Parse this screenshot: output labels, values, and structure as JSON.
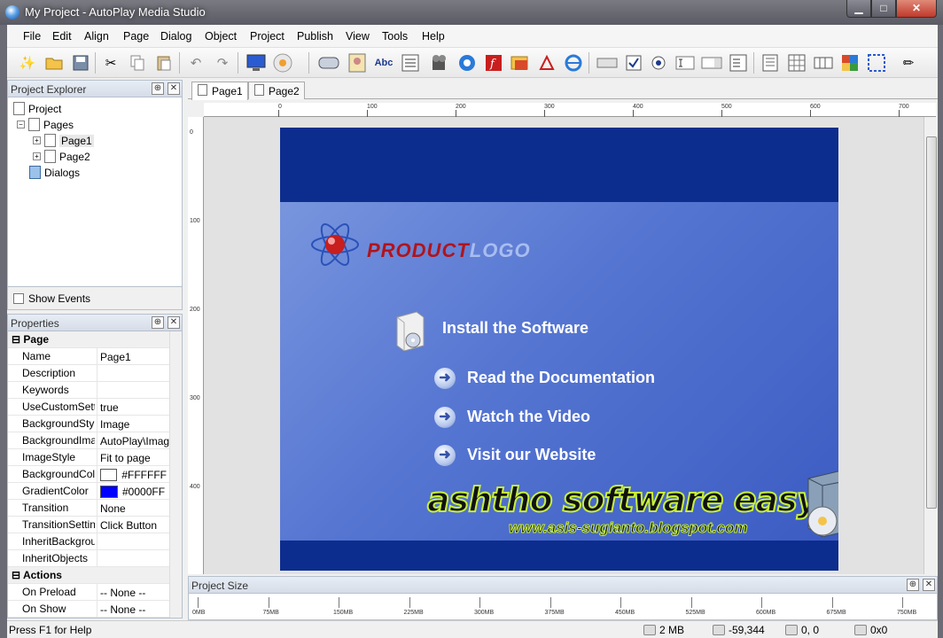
{
  "window": {
    "title": "My Project - AutoPlay Media Studio",
    "controls": {
      "minimize": "▁",
      "maximize": "□",
      "close": "✕"
    }
  },
  "menubar": [
    "File",
    "Edit",
    "Align",
    "Page",
    "Dialog",
    "Object",
    "Project",
    "Publish",
    "View",
    "Tools",
    "Help"
  ],
  "toolbar": {
    "icons": [
      "wizard-icon",
      "open-folder-icon",
      "save-icon",
      "cut-icon",
      "copy-icon",
      "paste-icon",
      "undo-icon",
      "redo-icon",
      "preview-icon",
      "build-icon",
      "button-object-icon",
      "image-object-icon",
      "label-object-icon",
      "paragraph-object-icon",
      "video-object-icon",
      "quicktime-object-icon",
      "flash-object-icon",
      "slideshow-object-icon",
      "pdf-object-icon",
      "web-object-icon",
      "input-object-icon",
      "checkbox-object-icon",
      "radio-object-icon",
      "textbox-object-icon",
      "combobox-object-icon",
      "listbox-object-icon",
      "page-properties-icon",
      "grid-icon",
      "tabs-icon",
      "color-icon",
      "selection-icon",
      "pencil-icon"
    ]
  },
  "explorer": {
    "title": "Project Explorer",
    "tree": {
      "root": "Project",
      "pages": "Pages",
      "page1": "Page1",
      "page2": "Page2",
      "dialogs": "Dialogs"
    },
    "show_events": "Show Events"
  },
  "properties": {
    "title": "Properties",
    "rows": [
      {
        "cat": true,
        "key": "Page"
      },
      {
        "key": "Name",
        "val": "Page1"
      },
      {
        "key": "Description",
        "val": ""
      },
      {
        "key": "Keywords",
        "val": ""
      },
      {
        "key": "UseCustomSett",
        "val": "true"
      },
      {
        "key": "BackgroundStyl",
        "val": "Image"
      },
      {
        "key": "BackgroundIma",
        "val": "AutoPlay\\Imag"
      },
      {
        "key": "ImageStyle",
        "val": "Fit to page"
      },
      {
        "key": "BackgroundCol",
        "val": "#FFFFFF",
        "swatch": "#FFFFFF"
      },
      {
        "key": "GradientColor",
        "val": "#0000FF",
        "swatch": "#0000FF"
      },
      {
        "key": "Transition",
        "val": "None"
      },
      {
        "key": "TransitionSettin",
        "val": "Click Button"
      },
      {
        "key": "InheritBackgrou",
        "val": ""
      },
      {
        "key": "InheritObjects",
        "val": ""
      },
      {
        "cat": true,
        "key": "Actions"
      },
      {
        "key": "On Preload",
        "val": "-- None --"
      },
      {
        "key": "On Show",
        "val": "-- None --"
      }
    ]
  },
  "tabs": [
    "Page1",
    "Page2"
  ],
  "ruler": {
    "h_labels": [
      "0",
      "100",
      "200",
      "300",
      "400",
      "500",
      "600",
      "700"
    ],
    "v_labels": [
      "0",
      "100",
      "200",
      "300",
      "400"
    ]
  },
  "page": {
    "logo_red": "PRODUCT",
    "logo_blue": "LOGO",
    "install": "Install the Software",
    "items": [
      "Read the Documentation",
      "Watch the Video",
      "Visit our Website"
    ],
    "watermark": "ashtho software easy",
    "watermark_url": "www.asis-sugianto.blogspot.com"
  },
  "project_size": {
    "title": "Project Size",
    "labels": [
      "0MB",
      "75MB",
      "150MB",
      "225MB",
      "300MB",
      "375MB",
      "450MB",
      "525MB",
      "600MB",
      "675MB",
      "750MB"
    ]
  },
  "statusbar": {
    "help": "Press F1 for Help",
    "size": "2 MB",
    "cursor": "-59,344",
    "position": "0, 0",
    "dimensions": "0x0"
  },
  "colors": {
    "page_dark": "#0d2d8e",
    "logo_red": "#b0141c",
    "logo_blue": "#a8bdf0",
    "watermark_outline": "#c8f03a"
  }
}
